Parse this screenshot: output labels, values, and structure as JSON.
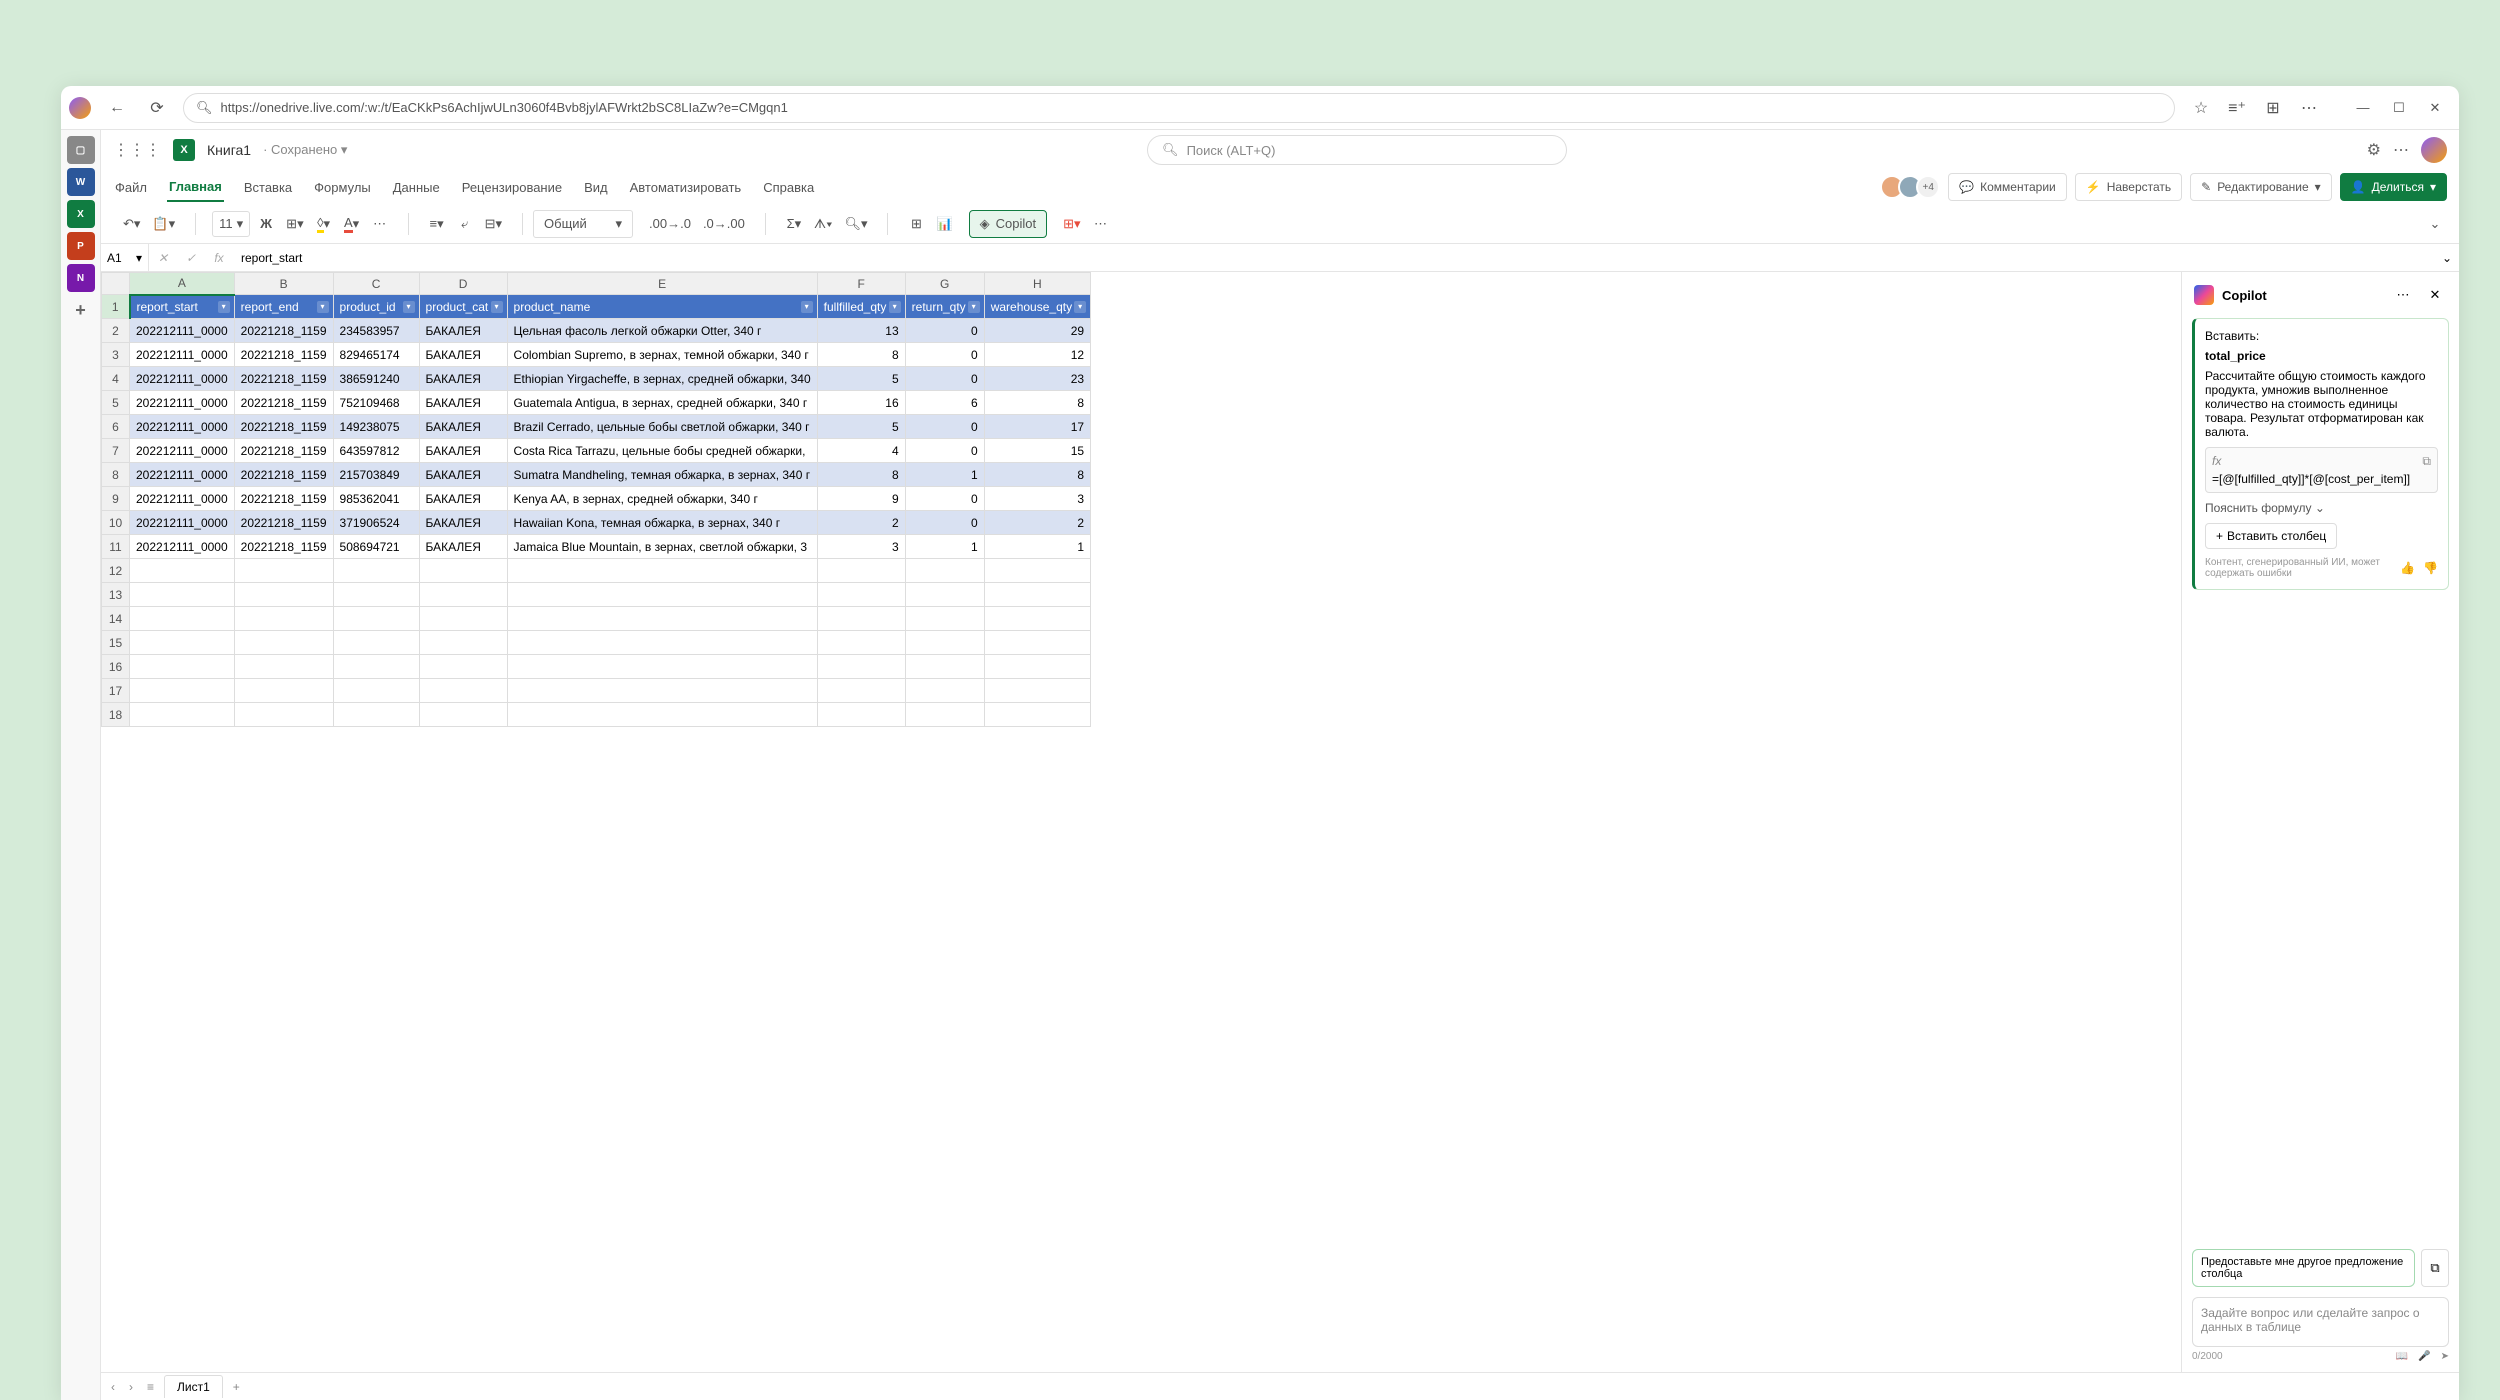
{
  "browser": {
    "url": "https://onedrive.live.com/:w:/t/EaCKkPs6AchIjwULn3060f4Bvb8jylAFWrkt2bSC8LIaZw?e=CMgqn1"
  },
  "app": {
    "docTitle": "Книга1",
    "savedStatus": "Сохранено",
    "searchPlaceholder": "Поиск (ALT+Q)"
  },
  "menu": {
    "file": "Файл",
    "home": "Главная",
    "insert": "Вставка",
    "formulas": "Формулы",
    "data": "Данные",
    "review": "Рецензирование",
    "view": "Вид",
    "automate": "Автоматизировать",
    "help": "Справка"
  },
  "collab": {
    "moreCount": "+4",
    "comments": "Комментарии",
    "catchup": "Наверстать",
    "editing": "Редактирование",
    "share": "Делиться"
  },
  "toolbar": {
    "fontSize": "11",
    "numberFormat": "Общий",
    "copilot": "Copilot"
  },
  "nameBox": {
    "cell": "A1",
    "formula": "report_start"
  },
  "columns": [
    "A",
    "B",
    "C",
    "D",
    "E",
    "F",
    "G",
    "H"
  ],
  "rows": [
    1,
    2,
    3,
    4,
    5,
    6,
    7,
    8,
    9,
    10,
    11,
    12,
    13,
    14,
    15,
    16,
    17,
    18
  ],
  "tableHeaders": [
    "report_start",
    "report_end",
    "product_id",
    "product_cat",
    "product_name",
    "fullfilled_qty",
    "return_qty",
    "warehouse_qty"
  ],
  "tableData": [
    [
      "202212111_0000",
      "20221218_1159",
      "234583957",
      "БАКАЛЕЯ",
      "Цельная фасоль легкой обжарки Otter, 340 г",
      "13",
      "0",
      "29"
    ],
    [
      "202212111_0000",
      "20221218_1159",
      "829465174",
      "БАКАЛЕЯ",
      "Colombian Supremo, в зернах, темной обжарки, 340 г",
      "8",
      "0",
      "12"
    ],
    [
      "202212111_0000",
      "20221218_1159",
      "386591240",
      "БАКАЛЕЯ",
      "Ethiopian Yirgacheffe, в зернах, средней обжарки, 340",
      "5",
      "0",
      "23"
    ],
    [
      "202212111_0000",
      "20221218_1159",
      "752109468",
      "БАКАЛЕЯ",
      "Guatemala Antigua, в зернах, средней обжарки, 340 г",
      "16",
      "6",
      "8"
    ],
    [
      "202212111_0000",
      "20221218_1159",
      "149238075",
      "БАКАЛЕЯ",
      "Brazil Cerrado, цельные бобы светлой обжарки, 340 г",
      "5",
      "0",
      "17"
    ],
    [
      "202212111_0000",
      "20221218_1159",
      "643597812",
      "БАКАЛЕЯ",
      "Costa Rica Tarrazu, цельные бобы средней обжарки,",
      "4",
      "0",
      "15"
    ],
    [
      "202212111_0000",
      "20221218_1159",
      "215703849",
      "БАКАЛЕЯ",
      "Sumatra Mandheling, темная обжарка, в зернах, 340 г",
      "8",
      "1",
      "8"
    ],
    [
      "202212111_0000",
      "20221218_1159",
      "985362041",
      "БАКАЛЕЯ",
      "Kenya AA, в зернах, средней обжарки, 340 г",
      "9",
      "0",
      "3"
    ],
    [
      "202212111_0000",
      "20221218_1159",
      "371906524",
      "БАКАЛЕЯ",
      "Hawaiian Kona, темная обжарка, в зернах, 340 г",
      "2",
      "0",
      "2"
    ],
    [
      "202212111_0000",
      "20221218_1159",
      "508694721",
      "БАКАЛЕЯ",
      "Jamaica Blue Mountain, в зернах, светлой обжарки, 3",
      "3",
      "1",
      "1"
    ]
  ],
  "copilot": {
    "title": "Copilot",
    "insertLabel": "Вставить:",
    "columnName": "total_price",
    "description": "Рассчитайте общую стоимость каждого продукта, умножив выполненное количество на стоимость единицы товара. Результат отформатирован как валюта.",
    "formula": "=[@[fulfilled_qty]]*[@[cost_per_item]]",
    "explain": "Пояснить формулу",
    "insertColumn": "Вставить столбец",
    "disclaimer": "Контент, сгенерированный ИИ, может содержать ошибки",
    "suggestion": "Предоставьте мне другое предложение столбца",
    "placeholder": "Задайте вопрос или сделайте запрос о данных в таблице",
    "charCount": "0/2000"
  },
  "sheets": {
    "sheet1": "Лист1"
  }
}
